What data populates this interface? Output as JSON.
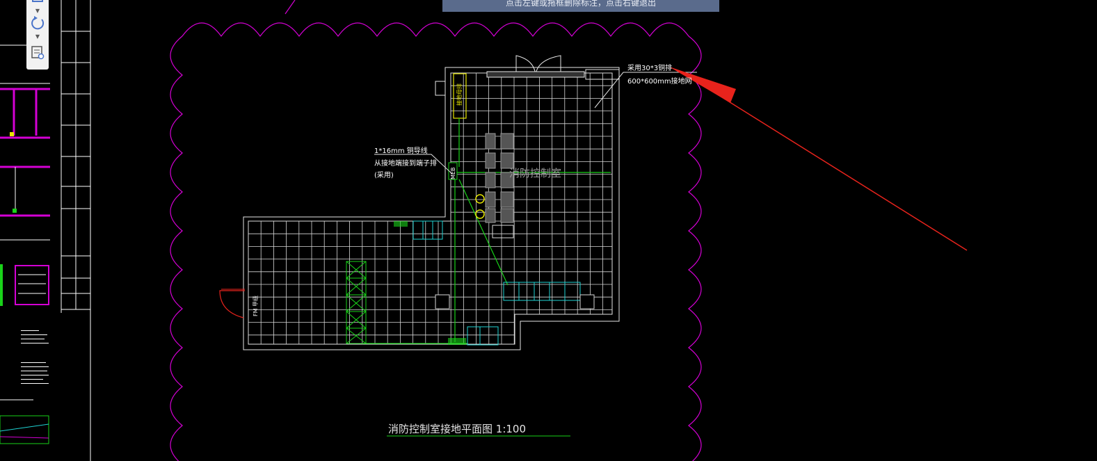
{
  "tooltip": {
    "text": "点击左键或拖框删除标注，点击右键退出"
  },
  "toolstrip": {
    "pan_icon": "pan-icon",
    "rotate_icon": "rotate-icon",
    "list_view_icon": "list-view-icon"
  },
  "drawing": {
    "title": "消防控制室接地平面图 1:100",
    "room_label": "消防控制室",
    "meb_label": "MEB",
    "note_ground_1": "采用30*3铜排",
    "note_ground_2": "600*600mm接地网",
    "note_wire_1": "1*16mm 铜导线",
    "note_wire_2": "从接地端接到端子排",
    "note_wire_3": "(采用)",
    "door_label": "FM 甲级",
    "riser_label": "接地母排"
  },
  "colors": {
    "background": "#000000",
    "revision_cloud": "#d400d4",
    "grid": "#e6e6e6",
    "ground_line": "#19d219",
    "equipment": "#1fd3d3",
    "annotation_arrow": "#e8231c",
    "accent_yellow": "#e6e600"
  }
}
